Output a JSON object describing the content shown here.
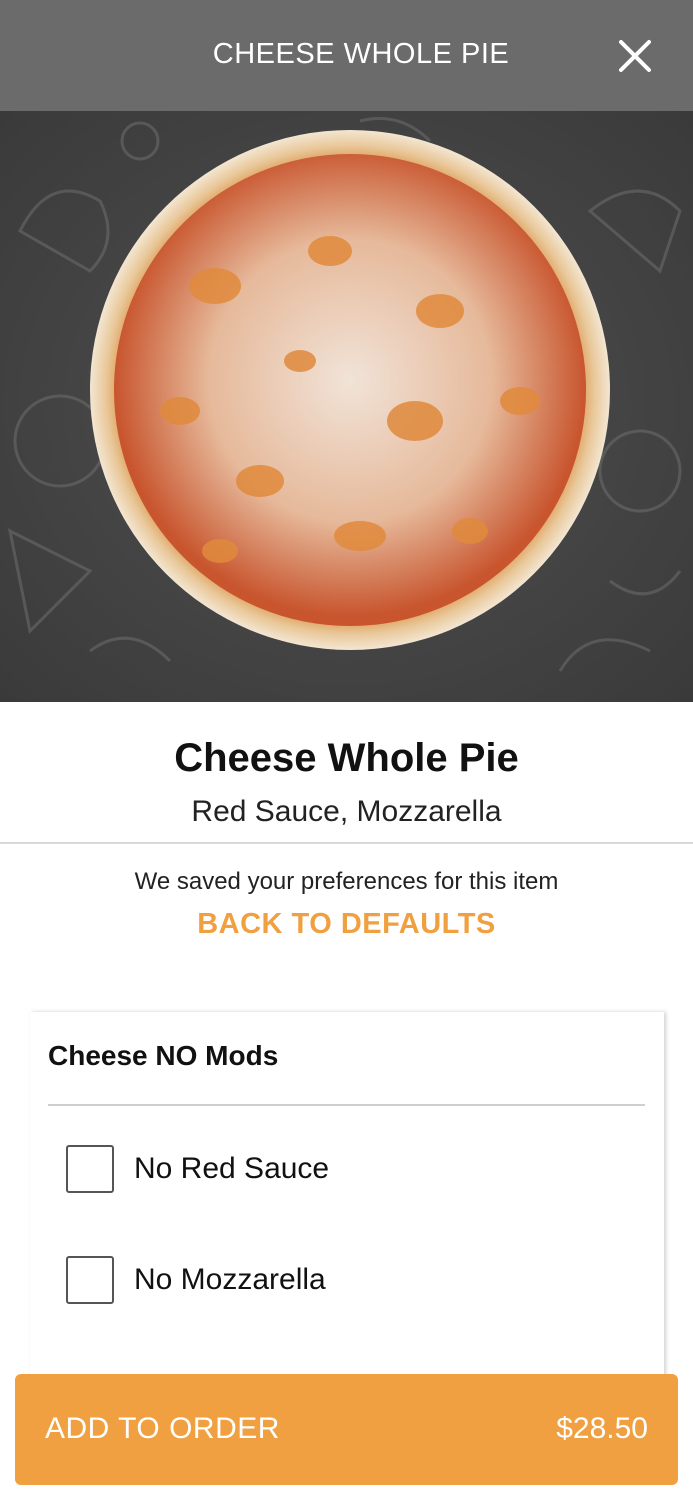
{
  "header": {
    "title": "CHEESE WHOLE PIE",
    "close_icon": "close-icon"
  },
  "hero": {
    "image": "cheese-pizza-photo"
  },
  "item": {
    "name": "Cheese Whole Pie",
    "description": "Red Sauce, Mozzarella"
  },
  "preferences": {
    "message": "We saved your preferences for this item",
    "reset_label": "BACK TO DEFAULTS"
  },
  "modifiers": {
    "title": "Cheese NO Mods",
    "options": [
      {
        "label": "No Red Sauce",
        "checked": false
      },
      {
        "label": "No Mozzarella",
        "checked": false
      }
    ]
  },
  "footer": {
    "add_label": "ADD TO ORDER",
    "price": "$28.50"
  },
  "colors": {
    "header_bg": "#6b6b6b",
    "accent": "#f0a040"
  }
}
